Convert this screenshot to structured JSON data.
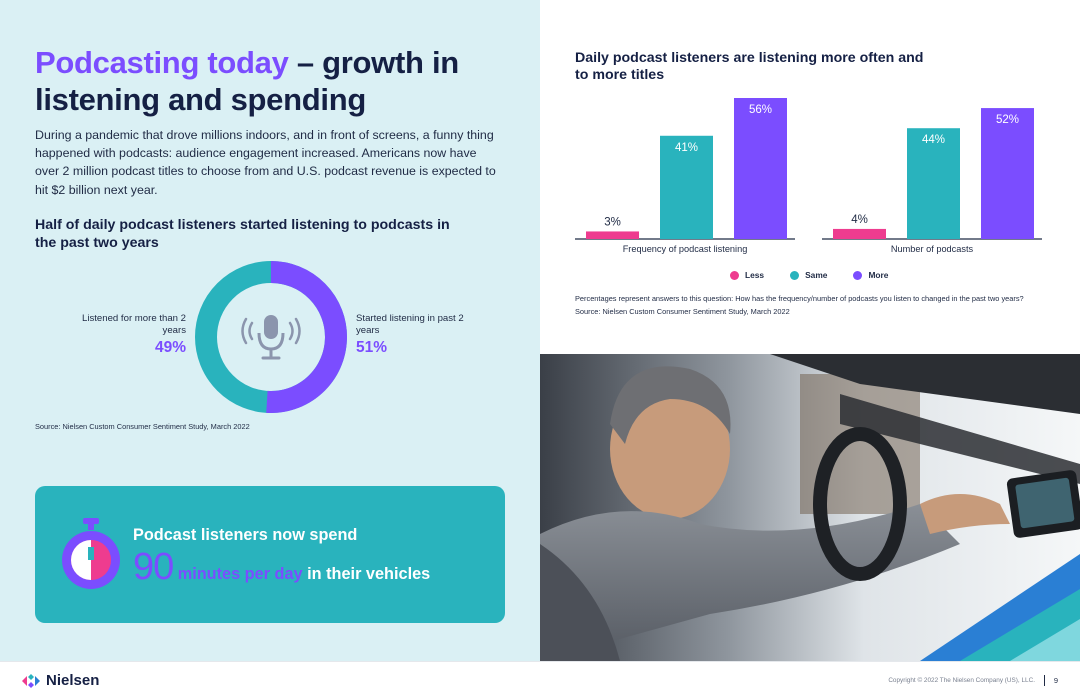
{
  "header": {
    "title_accent": "Podcasting today",
    "title_rest": " – growth in listening and spending",
    "intro": "During a pandemic that drove millions indoors, and in front of screens, a funny thing happened with podcasts: audience engagement increased. Americans now have over 2 million podcast titles to choose from and U.S. podcast revenue is expected to hit $2 billion next year."
  },
  "donut": {
    "heading": "Half of daily podcast listeners started listening to podcasts in the past two years",
    "left_label": "Listened for more than 2 years",
    "left_pct": "49%",
    "left_value": 49,
    "right_label": "Started listening in past 2 years",
    "right_pct": "51%",
    "right_value": 51,
    "center_icon": "microphone-icon",
    "colors": {
      "left": "#29b3bd",
      "right": "#7b4dff"
    },
    "source": "Source: Nielsen Custom Consumer Sentiment Study, March 2022"
  },
  "callout": {
    "line1": "Podcast listeners now spend",
    "number": "90",
    "unit": "minutes per day",
    "rest": " in their vehicles",
    "icon": "stopwatch-icon"
  },
  "chart_title": "Daily podcast listeners are listening more often and to more titles",
  "chart_data": {
    "type": "bar",
    "categories": [
      "Frequency of podcast listening",
      "Number of podcasts"
    ],
    "series": [
      {
        "name": "Less",
        "values": [
          3,
          4
        ],
        "color": "#ee3c8f"
      },
      {
        "name": "Same",
        "values": [
          41,
          44
        ],
        "color": "#29b3bd"
      },
      {
        "name": "More",
        "values": [
          56,
          52
        ],
        "color": "#7b4dff"
      }
    ],
    "ylim": [
      0,
      56
    ],
    "legend": "bottom-center"
  },
  "chart_note": {
    "question": "Percentages represent answers to this question: How has the frequency/number of podcasts you listen to changed in the past two years?",
    "source": "Source: Nielsen Custom Consumer Sentiment Study, March 2022"
  },
  "photo": {
    "description_icon": "car-driver-photo"
  },
  "footer": {
    "logo": "Nielsen",
    "copyright": "Copyright © 2022 The Nielsen Company (US), LLC.",
    "page": "9"
  }
}
